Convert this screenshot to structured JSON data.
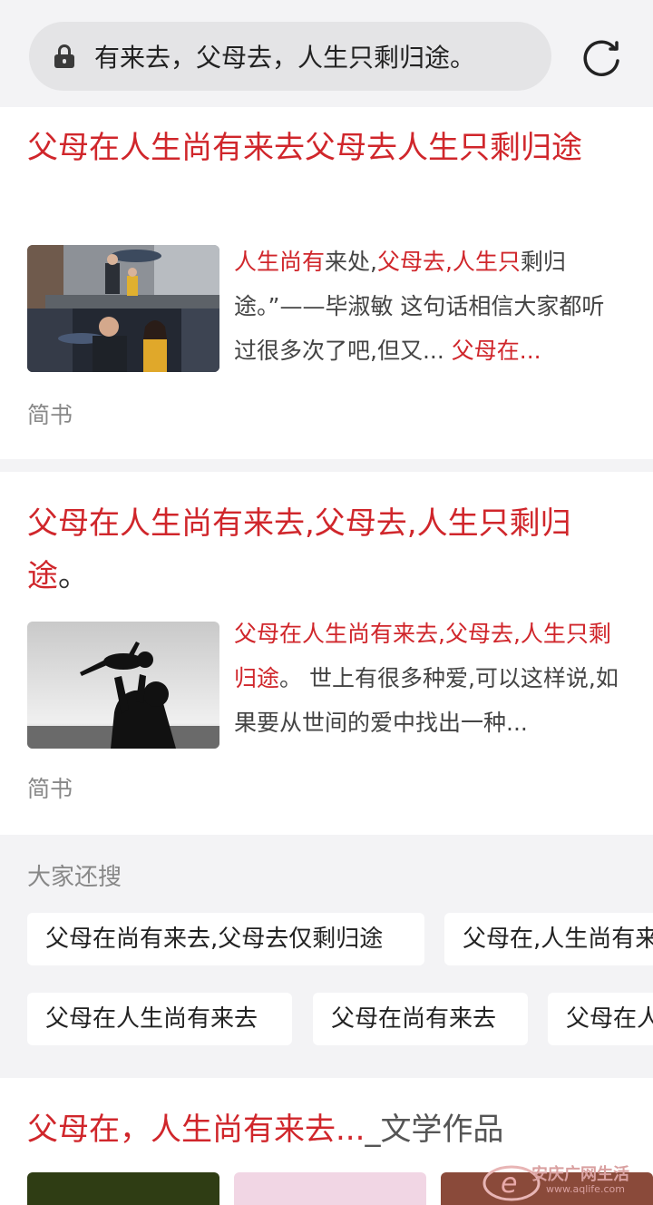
{
  "address_bar": {
    "query": "有来去，父母去，人生只剩归途。"
  },
  "results": [
    {
      "title_parts": [
        "父母在人生尚有来去父母去人生只剩归途"
      ],
      "snippet": [
        {
          "text": "人生尚有",
          "hl": true
        },
        {
          "text": "来处,",
          "hl": false
        },
        {
          "text": "父母去,人生只",
          "hl": true
        },
        {
          "text": "剩归途。”——毕淑敏 这句话相信大家都听过很多次了吧,但又... ",
          "hl": false
        },
        {
          "text": "父母在...",
          "hl": true
        }
      ],
      "source": "简书"
    },
    {
      "title_main": "父母在人生尚有来去,父母去,人生只剩归途",
      "title_tail": "。",
      "snippet": [
        {
          "text": "父母在人生尚有来去,父母去,人生只剩归途",
          "hl": true
        },
        {
          "text": "。 世上有很多种爱,可以这样说,如果要从世间的爱中找出一种...",
          "hl": false
        }
      ],
      "source": "简书"
    }
  ],
  "related": {
    "title": "大家还搜",
    "row1": [
      "父母在尚有来去,父母去仅剩归途",
      "父母在,人生尚有来去"
    ],
    "row2": [
      "父母在人生尚有来去",
      "父母在尚有来去",
      "父母在人生尚有"
    ]
  },
  "result3": {
    "title_main": "父母在，人生尚有来去...",
    "title_tail": "_文学作品"
  },
  "watermark": {
    "text": "安庆广网生活",
    "url": "www.aqlife.com"
  },
  "colors": {
    "accent_red": "#d0262b",
    "page_bg": "#f3f3f5"
  },
  "icons": [
    "lock-icon",
    "reload-icon"
  ]
}
